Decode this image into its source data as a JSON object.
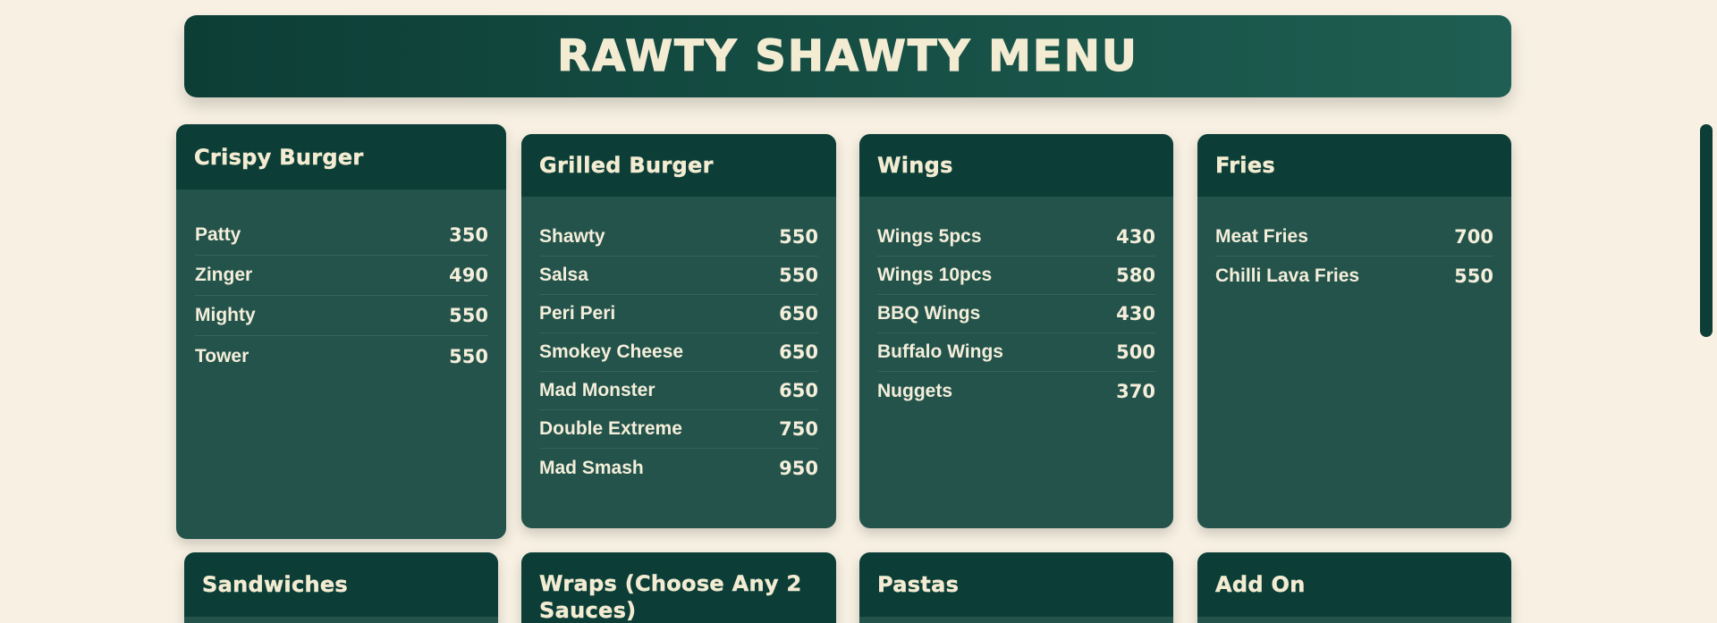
{
  "header": {
    "title": "RAWTY SHAWTY MENU"
  },
  "categories": [
    {
      "title": "Crispy Burger",
      "items": [
        {
          "name": "Patty",
          "price": "350"
        },
        {
          "name": "Zinger",
          "price": "490"
        },
        {
          "name": "Mighty",
          "price": "550"
        },
        {
          "name": "Tower",
          "price": "550"
        }
      ]
    },
    {
      "title": "Grilled Burger",
      "items": [
        {
          "name": "Shawty",
          "price": "550"
        },
        {
          "name": "Salsa",
          "price": "550"
        },
        {
          "name": "Peri Peri",
          "price": "650"
        },
        {
          "name": "Smokey Cheese",
          "price": "650"
        },
        {
          "name": "Mad Monster",
          "price": "650"
        },
        {
          "name": "Double Extreme",
          "price": "750"
        },
        {
          "name": "Mad Smash",
          "price": "950"
        }
      ]
    },
    {
      "title": "Wings",
      "items": [
        {
          "name": "Wings 5pcs",
          "price": "430"
        },
        {
          "name": "Wings 10pcs",
          "price": "580"
        },
        {
          "name": "BBQ Wings",
          "price": "430"
        },
        {
          "name": "Buffalo Wings",
          "price": "500"
        },
        {
          "name": "Nuggets",
          "price": "370"
        }
      ]
    },
    {
      "title": "Fries",
      "items": [
        {
          "name": "Meat Fries",
          "price": "700"
        },
        {
          "name": "Chilli Lava Fries",
          "price": "550"
        }
      ]
    },
    {
      "title": "Sandwiches",
      "items": []
    },
    {
      "title": "Wraps (Choose Any 2 Sauces)",
      "items": []
    },
    {
      "title": "Pastas",
      "items": []
    },
    {
      "title": "Add On",
      "items": []
    }
  ]
}
